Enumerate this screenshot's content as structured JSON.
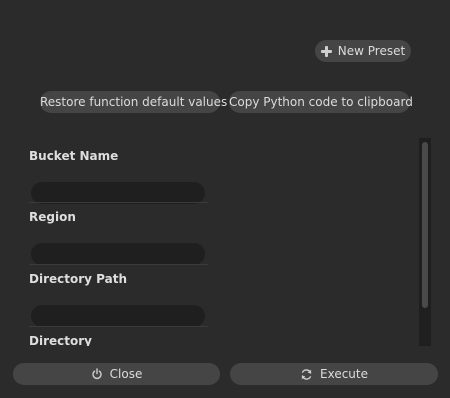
{
  "header": {
    "new_preset_label": "New Preset"
  },
  "toolbar": {
    "restore_label": "Restore function default values",
    "copy_label": "Copy Python code to clipboard"
  },
  "form": {
    "fields": [
      {
        "label": "Bucket Name",
        "value": ""
      },
      {
        "label": "Region",
        "value": ""
      },
      {
        "label": "Directory Path",
        "value": ""
      },
      {
        "label": "Directory",
        "value": ""
      }
    ]
  },
  "footer": {
    "close_label": "Close",
    "execute_label": "Execute"
  },
  "icons": {
    "new_preset": "plus-icon",
    "close": "power-icon",
    "execute": "refresh-icon"
  },
  "colors": {
    "background": "#2b2b2b",
    "button": "#454545",
    "input": "#1f1f1f",
    "text": "#dcdcdc"
  }
}
